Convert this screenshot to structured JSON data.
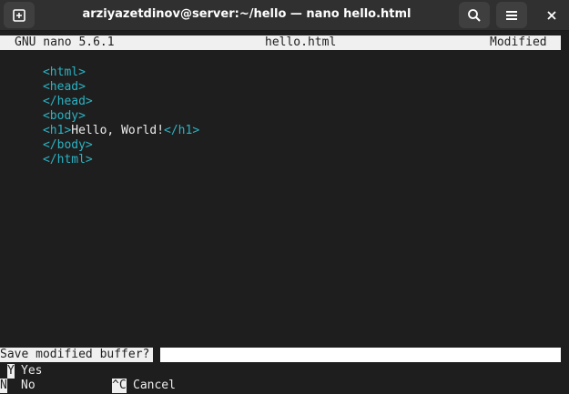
{
  "window": {
    "title": "arziyazetdinov@server:~/hello — nano hello.html"
  },
  "icons": {
    "new_tab": "new-tab-icon",
    "search": "search-icon",
    "menu": "hamburger-menu-icon",
    "close": "close-icon"
  },
  "nano": {
    "version": "GNU nano 5.6.1",
    "filename": "hello.html",
    "state": "Modified"
  },
  "file_lines": [
    {
      "tag_open": "<html>",
      "text": "",
      "tag_close": ""
    },
    {
      "tag_open": "<head>",
      "text": "",
      "tag_close": ""
    },
    {
      "tag_open": "</head>",
      "text": "",
      "tag_close": ""
    },
    {
      "tag_open": "<body>",
      "text": "",
      "tag_close": ""
    },
    {
      "tag_open": "<h1>",
      "text": "Hello, World!",
      "tag_close": "</h1>"
    },
    {
      "tag_open": "</body>",
      "text": "",
      "tag_close": ""
    },
    {
      "tag_open": "</html>",
      "text": "",
      "tag_close": ""
    }
  ],
  "prompt": {
    "question": "Save modified buffer?",
    "value": ""
  },
  "shortcuts": [
    {
      "key": "Y",
      "label": "Yes"
    },
    {
      "key": "N",
      "label": "No"
    },
    {
      "key": "^C",
      "label": "Cancel"
    }
  ],
  "colors": {
    "tag": "#2bb3c4",
    "inverse_bg": "#f0f0f0",
    "terminal_bg": "#1e1e1e"
  }
}
